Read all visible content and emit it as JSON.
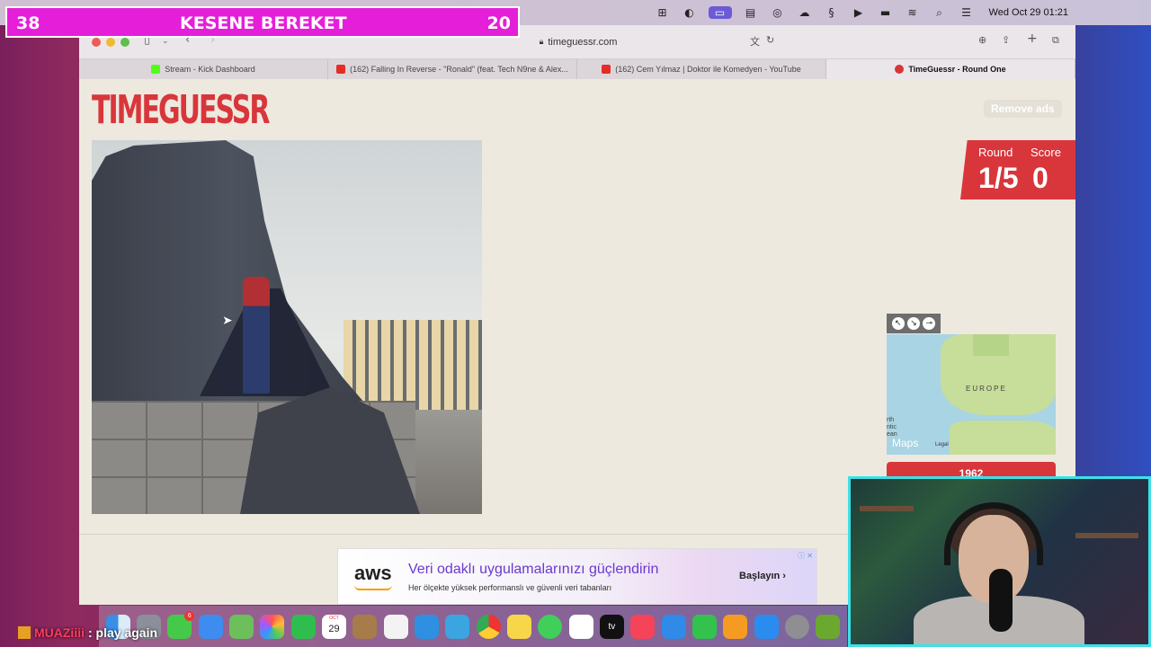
{
  "menubar": {
    "icons": [
      "⊞",
      "◐",
      "▭",
      "▤",
      "◎",
      "☁",
      "§",
      "▶",
      "▬",
      "≋",
      "⌕",
      "☰"
    ],
    "clock": "Wed Oct 29  01:21"
  },
  "overlay": {
    "left_score": "38",
    "title": "KESENE BEREKET",
    "right_score": "20"
  },
  "browser": {
    "url": "timeguessr.com",
    "tabs": [
      {
        "label": "Stream - Kick Dashboard",
        "icon": "kick-icon"
      },
      {
        "label": "(162) Falling In Reverse - \"Ronald\" (feat. Tech N9ne & Alex...",
        "icon": "youtube-icon"
      },
      {
        "label": "(162) Cem Yılmaz | Doktor ile Komedyen - YouTube",
        "icon": "youtube-icon"
      },
      {
        "label": "TimeGuessr - Round One",
        "icon": "timeguessr-icon"
      }
    ]
  },
  "page": {
    "logo": "TIMEGUESSR",
    "remove_ads": "Remove ads",
    "round_label": "Round",
    "round_value": "1/5",
    "score_label": "Score",
    "score_value": "0",
    "map": {
      "region_label": "EUROPE",
      "partial_label": "rth\nntic\nean",
      "brand": "Maps",
      "legal": "Legal"
    },
    "guess_button": "1962"
  },
  "ad": {
    "logo": "aws",
    "title": "Veri odaklı uygulamalarınızı güçlendirin",
    "subtitle": "Her ölçekte yüksek performanslı ve güvenli veri tabanları",
    "cta": "Başlayın  ›",
    "badge": "ⓘ ✕"
  },
  "dock": {
    "apps": [
      "finder",
      "launchpad",
      "messages",
      "mail",
      "maps",
      "photos",
      "facetime",
      "calendar",
      "notes-box",
      "reminders",
      "safari",
      "telegram",
      "chrome",
      "notes",
      "whatsapp",
      "freeform",
      "tv",
      "music",
      "keynote",
      "numbers",
      "pages",
      "app-store",
      "system-settings",
      "games"
    ],
    "calendar_day": "29",
    "messages_badge": "6",
    "tv_label": "tv"
  },
  "chat": {
    "user": "MUAZiiii",
    "message": ": play again"
  },
  "colors": {
    "brand_red": "#d8363b",
    "overlay_pink": "#e51fd9",
    "webcam_border": "#3ee0e8"
  }
}
